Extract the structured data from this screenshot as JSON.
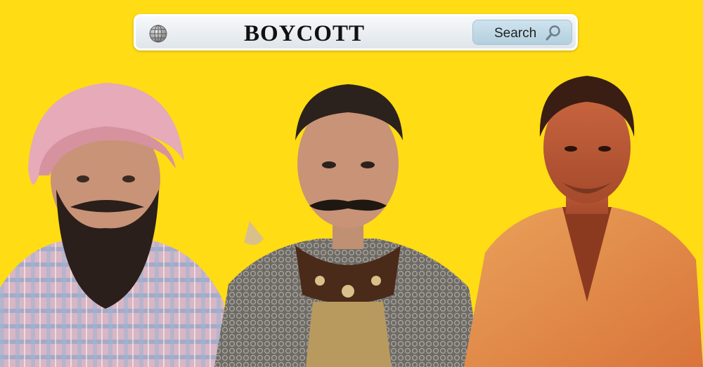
{
  "search": {
    "query": "BOYCOTT",
    "button_label": "Search"
  },
  "icons": {
    "globe": "globe-icon",
    "search": "magnifier-icon"
  },
  "colors": {
    "background": "#ffdc14",
    "search_button": "#bcd6e4"
  }
}
